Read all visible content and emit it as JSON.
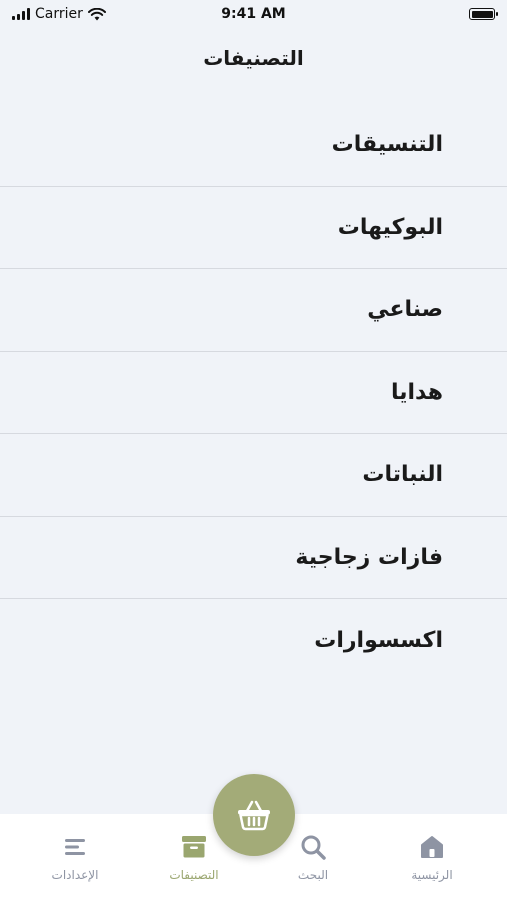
{
  "status_bar": {
    "carrier": "Carrier",
    "time": "9:41 AM"
  },
  "header": {
    "title": "التصنيفات"
  },
  "categories": [
    {
      "label": "التنسيقات"
    },
    {
      "label": "البوكيهات"
    },
    {
      "label": "صناعي"
    },
    {
      "label": "هدايا"
    },
    {
      "label": "النباتات"
    },
    {
      "label": "فازات زجاجية"
    },
    {
      "label": "اكسسوارات"
    }
  ],
  "tab_bar": {
    "settings": {
      "label": "الإعدادات",
      "icon": "menu-lines-icon"
    },
    "categories": {
      "label": "التصنيفات",
      "icon": "archive-box-icon",
      "active": true
    },
    "search": {
      "label": "البحث",
      "icon": "search-icon"
    },
    "home": {
      "label": "الرئيسية",
      "icon": "home-icon"
    }
  },
  "cart_button": {
    "icon": "basket-icon"
  },
  "colors": {
    "background": "#f0f3f8",
    "accent": "#a3ab78",
    "active_tab": "#9aa66f",
    "inactive_tab": "#8e94a3"
  }
}
